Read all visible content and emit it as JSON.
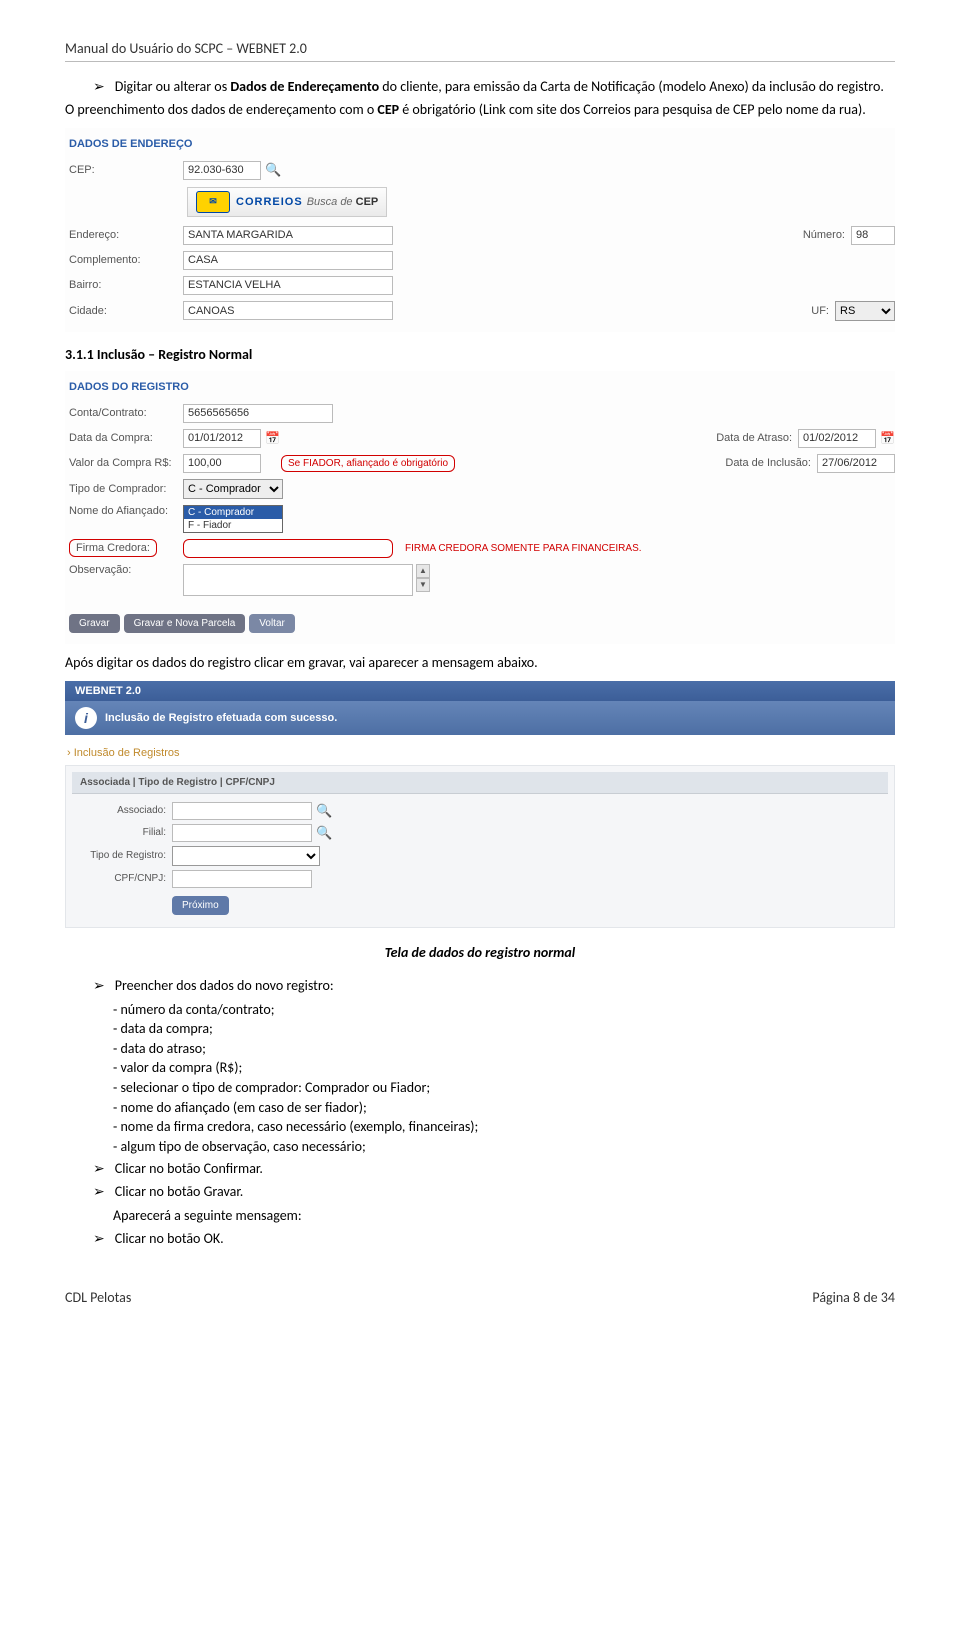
{
  "header": "Manual do Usuário do SCPC – WEBNET 2.0",
  "intro": {
    "bullet": "Digitar ou alterar os Dados de Endereçamento do cliente, para emissão da Carta de Notificação (modelo Anexo) da inclusão do registro.",
    "para": "O preenchimento dos dados de endereçamento com o CEP é obrigatório (Link com site dos Correios para pesquisa de CEP pelo nome da rua).",
    "cep_bold": "CEP"
  },
  "form1": {
    "title": "DADOS DE ENDEREÇO",
    "cep_lbl": "CEP:",
    "cep_val": "92.030-630",
    "correios": {
      "brand": "CORREIOS",
      "busca": "Busca de",
      "cep": "CEP"
    },
    "end_lbl": "Endereço:",
    "end_val": "SANTA MARGARIDA",
    "num_lbl": "Número:",
    "num_val": "98",
    "comp_lbl": "Complemento:",
    "comp_val": "CASA",
    "bairro_lbl": "Bairro:",
    "bairro_val": "ESTANCIA VELHA",
    "cid_lbl": "Cidade:",
    "cid_val": "CANOAS",
    "uf_lbl": "UF:",
    "uf_val": "RS"
  },
  "h311": "3.1.1    Inclusão – Registro Normal",
  "form2": {
    "title": "DADOS DO REGISTRO",
    "conta_lbl": "Conta/Contrato:",
    "conta_val": "5656565656",
    "data_compra_lbl": "Data da Compra:",
    "data_compra_val": "01/01/2012",
    "data_atraso_lbl": "Data de Atraso:",
    "data_atraso_val": "01/02/2012",
    "valor_lbl": "Valor da Compra R$:",
    "valor_val": "100,00",
    "fiador_note": "Se FIADOR, afiançado é obrigatório",
    "data_inc_lbl": "Data de Inclusão:",
    "data_inc_val": "27/06/2012",
    "tipo_lbl": "Tipo de Comprador:",
    "tipo_val": "C - Comprador",
    "tipo_opts": [
      "C - Comprador",
      "F - Fiador"
    ],
    "nome_af_lbl": "Nome do Afiançado:",
    "firma_lbl": "Firma Credora:",
    "firma_note": "FIRMA CREDORA SOMENTE PARA FINANCEIRAS.",
    "obs_lbl": "Observação:",
    "btn_gravar": "Gravar",
    "btn_gravar_nova": "Gravar e Nova Parcela",
    "btn_voltar": "Voltar"
  },
  "after1": "Após digitar os dados do registro clicar em gravar, vai aparecer a mensagem abaixo.",
  "form3": {
    "webnet": "WEBNET 2.0",
    "msg": "Inclusão de Registro efetuada com sucesso.",
    "section": "Inclusão de Registros",
    "tab": "Associada | Tipo de Registro | CPF/CNPJ",
    "assoc_lbl": "Associado:",
    "filial_lbl": "Filial:",
    "tipo_lbl": "Tipo de Registro:",
    "cpf_lbl": "CPF/CNPJ:",
    "btn_proximo": "Próximo"
  },
  "caption": "Tela de dados do registro normal",
  "list": {
    "leader": "Preencher dos dados do novo registro:",
    "items": [
      "número da conta/contrato;",
      "data da compra;",
      "data do atraso;",
      "valor da compra (R$);",
      "selecionar o tipo de comprador: Comprador ou Fiador;",
      "nome do afiançado (em caso de ser fiador);",
      "nome da firma credora, caso necessário (exemplo, financeiras);",
      "algum tipo de observação, caso necessário;"
    ],
    "b2": "Clicar no botão Confirmar.",
    "b3": "Clicar no botão Gravar.",
    "b3x": "Aparecerá a seguinte mensagem:",
    "b4": "Clicar no botão OK."
  },
  "footer": {
    "left": "CDL Pelotas",
    "right": "Página 8 de 34"
  }
}
